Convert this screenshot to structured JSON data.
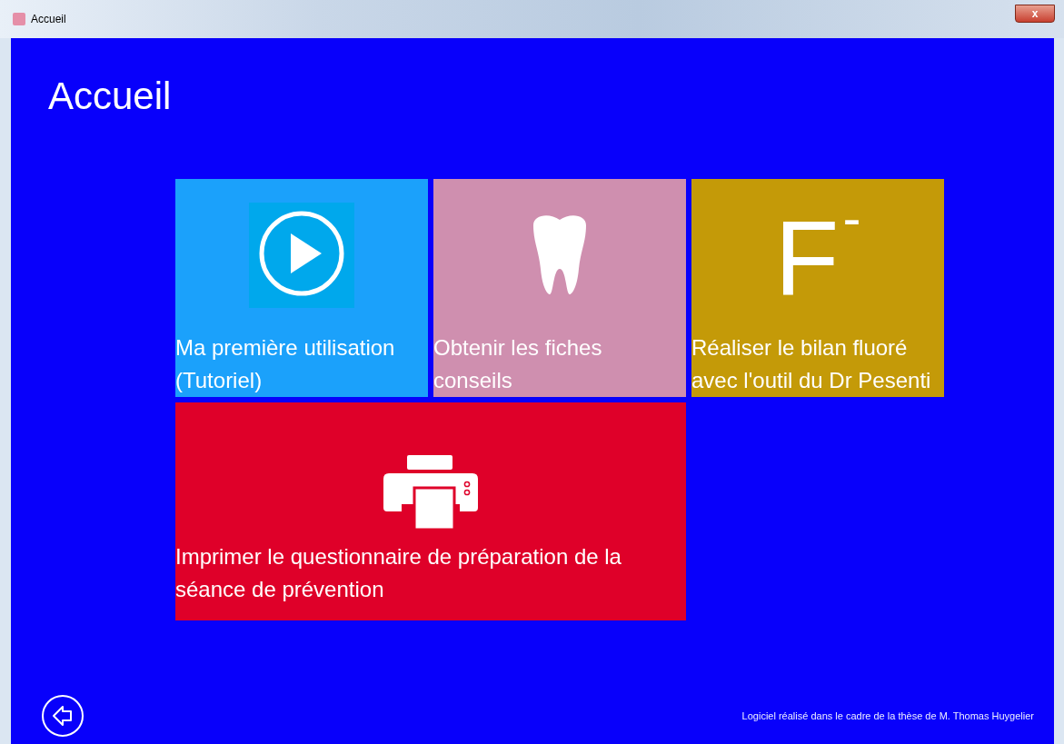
{
  "window": {
    "title": "Accueil",
    "close": "x"
  },
  "page_title": "Accueil",
  "tiles": [
    {
      "kind": "play",
      "label": "Ma première utilisation (Tutoriel)",
      "color": "#1ba1fb"
    },
    {
      "kind": "tooth",
      "label": "Obtenir les fiches conseils",
      "color": "#cf8faf"
    },
    {
      "kind": "fluor",
      "glyph": "F$^{-}$",
      "label": "Réaliser le bilan fluoré avec l'outil du Dr Pesenti",
      "color": "#c49a08"
    },
    {
      "kind": "printer",
      "label": "Imprimer le questionnaire de préparation de la séance de prévention",
      "color": "#df0029"
    }
  ],
  "footer": "Logiciel réalisé dans le cadre de la thèse de M. Thomas Huygelier"
}
